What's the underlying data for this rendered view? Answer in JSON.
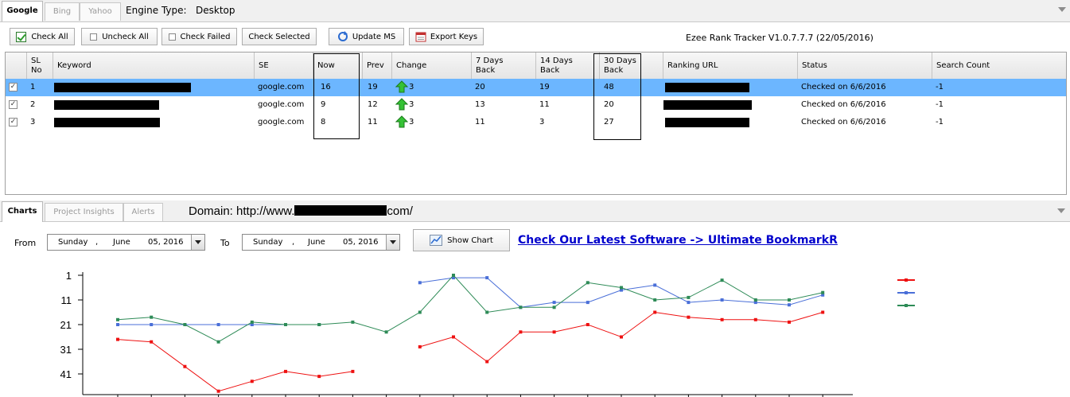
{
  "top_tabs": [
    "Google",
    "Bing",
    "Yahoo"
  ],
  "engine_type_label": "Engine Type:",
  "engine_type_value": "Desktop",
  "toolbar": {
    "check_all": "Check All",
    "uncheck_all": "Uncheck All",
    "check_failed": "Check Failed",
    "check_selected": "Check Selected",
    "update_ms": "Update MS",
    "export_keys": "Export Keys"
  },
  "app_version": "Ezee Rank Tracker V1.0.7.7.7 (22/05/2016)",
  "table": {
    "headers": {
      "sl_no": "SL\nNo",
      "keyword": "Keyword",
      "se": "SE",
      "now": "Now",
      "prev": "Prev",
      "change": "Change",
      "d7": "7 Days\nBack",
      "d14": "14 Days\nBack",
      "d30": "30 Days\nBack",
      "ranking_url": "Ranking URL",
      "status": "Status",
      "search_count": "Search Count"
    },
    "rows": [
      {
        "sl": "1",
        "se": "google.com",
        "now": "16",
        "prev": "19",
        "change": "3",
        "d7": "20",
        "d14": "19",
        "d30": "48",
        "status": "Checked on 6/6/2016",
        "count": "-1"
      },
      {
        "sl": "2",
        "se": "google.com",
        "now": "9",
        "prev": "12",
        "change": "3",
        "d7": "13",
        "d14": "11",
        "d30": "20",
        "status": "Checked on 6/6/2016",
        "count": "-1"
      },
      {
        "sl": "3",
        "se": "google.com",
        "now": "8",
        "prev": "11",
        "change": "3",
        "d7": "11",
        "d14": "3",
        "d30": "27",
        "status": "Checked on 6/6/2016",
        "count": "-1"
      }
    ]
  },
  "lower_tabs": [
    "Charts",
    "Project Insights",
    "Alerts"
  ],
  "domain_prefix": "Domain: http://www.",
  "domain_suffix": "com/",
  "from_label": "From",
  "to_label": "To",
  "from_date": {
    "day": "Sunday",
    "month": "June",
    "date": "05, 2016"
  },
  "to_date": {
    "day": "Sunday",
    "month": "June",
    "date": "05, 2016"
  },
  "show_chart": "Show Chart",
  "promo_link": "Check Our Latest Software -> Ultimate BookmarkR",
  "colors": {
    "red": "#ee1111",
    "blue": "#4a6fd8",
    "green": "#2e8b57",
    "selection": "#6cb6ff"
  },
  "chart_data": {
    "type": "line",
    "y_ticks": [
      "1",
      "11",
      "21",
      "31",
      "41"
    ],
    "ylim": [
      1,
      48
    ],
    "y_inverted": true,
    "x": [
      1,
      2,
      3,
      4,
      5,
      6,
      7,
      8,
      9,
      10,
      11,
      12,
      13,
      14,
      15,
      16,
      17,
      18,
      19,
      20,
      21,
      22,
      23,
      24
    ],
    "series": [
      {
        "color": "#ee1111",
        "values": [
          27,
          28,
          38,
          48,
          44,
          40,
          42,
          40,
          null,
          30,
          26,
          36,
          24,
          24,
          21,
          26,
          16,
          18,
          19,
          19,
          20,
          16
        ]
      },
      {
        "color": "#4a6fd8",
        "values": [
          21,
          21,
          21,
          21,
          21,
          21,
          21,
          null,
          null,
          4,
          2,
          2,
          14,
          12,
          12,
          7,
          5,
          12,
          11,
          12,
          13,
          9
        ]
      },
      {
        "color": "#2e8b57",
        "values": [
          19,
          18,
          21,
          28,
          20,
          21,
          21,
          20,
          24,
          16,
          1,
          16,
          14,
          14,
          4,
          6,
          11,
          10,
          3,
          11,
          11,
          8
        ]
      }
    ]
  }
}
